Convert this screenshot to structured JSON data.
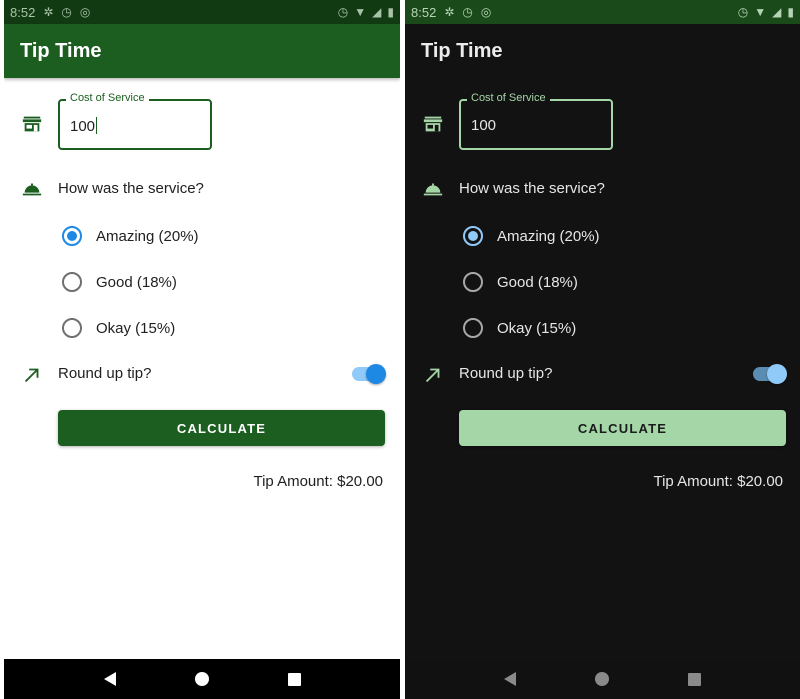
{
  "colors": {
    "primary": "#1b5e20",
    "primary_dark_theme": "#a5d6a7",
    "radio_accent": "#1e88e5",
    "radio_accent_dark": "#90caf9",
    "dark_background": "#121212"
  },
  "screens": [
    {
      "theme": "light",
      "status_bar": {
        "time": "8:52"
      },
      "app_bar": {
        "title": "Tip Time"
      },
      "cost_field": {
        "label": "Cost of Service",
        "value": "100"
      },
      "question": "How was the service?",
      "tip_options": [
        {
          "label": "Amazing (20%)",
          "selected": true
        },
        {
          "label": "Good (18%)",
          "selected": false
        },
        {
          "label": "Okay (15%)",
          "selected": false
        }
      ],
      "round_up": {
        "label": "Round up tip?",
        "enabled": true
      },
      "calculate_button": "CALCULATE",
      "tip_result": "Tip Amount: $20.00"
    },
    {
      "theme": "dark",
      "status_bar": {
        "time": "8:52"
      },
      "app_bar": {
        "title": "Tip Time"
      },
      "cost_field": {
        "label": "Cost of Service",
        "value": "100"
      },
      "question": "How was the service?",
      "tip_options": [
        {
          "label": "Amazing (20%)",
          "selected": true
        },
        {
          "label": "Good (18%)",
          "selected": false
        },
        {
          "label": "Okay (15%)",
          "selected": false
        }
      ],
      "round_up": {
        "label": "Round up tip?",
        "enabled": true
      },
      "calculate_button": "CALCULATE",
      "tip_result": "Tip Amount: $20.00"
    }
  ]
}
